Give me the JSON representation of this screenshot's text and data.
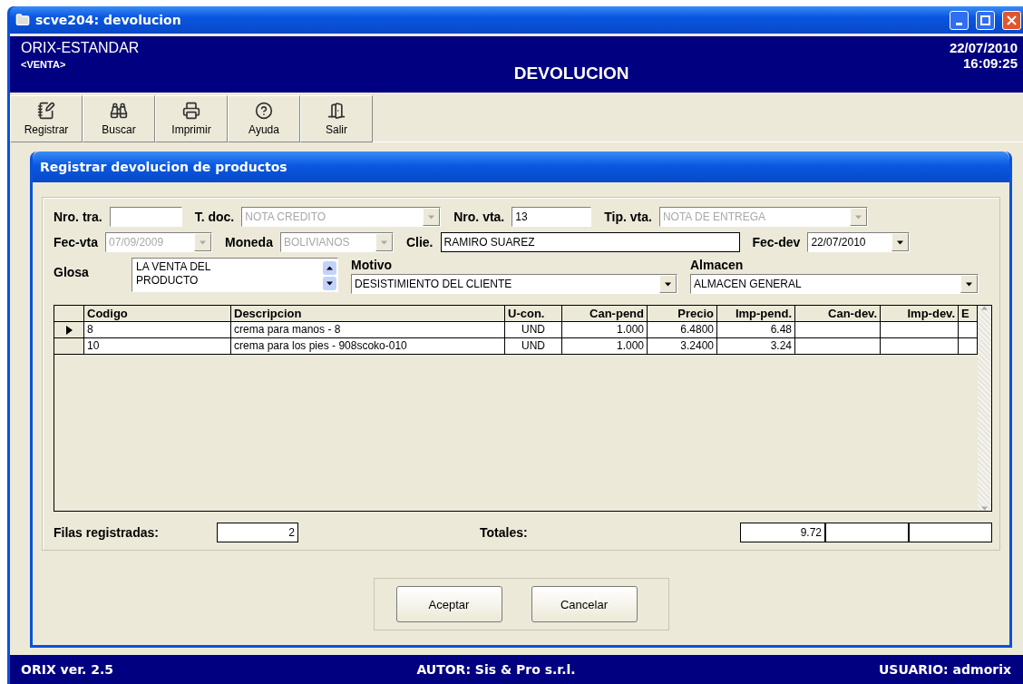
{
  "window": {
    "title": "scve204: devolucion"
  },
  "header": {
    "app": "ORIX-ESTANDAR",
    "module": "<VENTA>",
    "title": "DEVOLUCION",
    "date": "22/07/2010",
    "time": "16:09:25"
  },
  "toolbar": [
    {
      "label": "Registrar"
    },
    {
      "label": "Buscar"
    },
    {
      "label": "Imprimir"
    },
    {
      "label": "Ayuda"
    },
    {
      "label": "Salir"
    }
  ],
  "dialog": {
    "title": "Registrar devolucion de productos",
    "rows": [
      [
        {
          "kind": "text",
          "label": "Nro. tra."
        },
        {
          "kind": "combo",
          "label": "T. doc.",
          "value": "NOTA CREDITO",
          "disabled": true
        },
        {
          "kind": "text",
          "label": "Nro. vta.",
          "value": "13"
        },
        {
          "kind": "combo",
          "label": "Tip. vta.",
          "value": "NOTA DE ENTREGA",
          "disabled": true
        }
      ],
      [
        {
          "kind": "date",
          "label": "Fec-vta",
          "value": "07/09/2009",
          "disabled": true
        },
        {
          "kind": "combo",
          "label": "Moneda",
          "value": "BOLIVIANOS",
          "disabled": true
        },
        {
          "kind": "text",
          "label": "Clie.",
          "value": "RAMIRO SUAREZ"
        },
        {
          "kind": "date",
          "label": "Fec-dev",
          "value": "22/07/2010",
          "disabled": false
        }
      ]
    ],
    "glosa": {
      "label": "Glosa",
      "lines": [
        "LA VENTA DEL",
        "PRODUCTO"
      ]
    },
    "selects": [
      {
        "label": "Motivo",
        "value": "DESISTIMIENTO DEL CLIENTE"
      },
      {
        "label": "Almacen",
        "value": "ALMACEN GENERAL"
      }
    ],
    "table": {
      "columns": [
        "Codigo",
        "Descripcion",
        "U-con.",
        "Can-pend",
        "Precio",
        "Imp-pend.",
        "Can-dev.",
        "Imp-dev.",
        "E"
      ],
      "rows": [
        {
          "selected": true,
          "cells": [
            "8",
            "crema para manos - 8",
            "UND",
            "1.000",
            "6.4800",
            "6.48",
            "",
            "",
            ""
          ]
        },
        {
          "selected": false,
          "cells": [
            "10",
            "crema para los pies - 908scoko-010",
            "UND",
            "1.000",
            "3.2400",
            "3.24",
            "",
            "",
            ""
          ]
        }
      ]
    },
    "rows_label": "Filas registradas:",
    "rows_count": "2",
    "totals_label": "Totales:",
    "totals": [
      "9.72"
    ],
    "buttons": [
      {
        "label": "Aceptar"
      },
      {
        "label": "Cancelar"
      }
    ]
  },
  "status_bar": [
    "ORIX ver. 2.5",
    "AUTOR: Sis & Pro s.r.l.",
    "USUARIO: admorix"
  ]
}
